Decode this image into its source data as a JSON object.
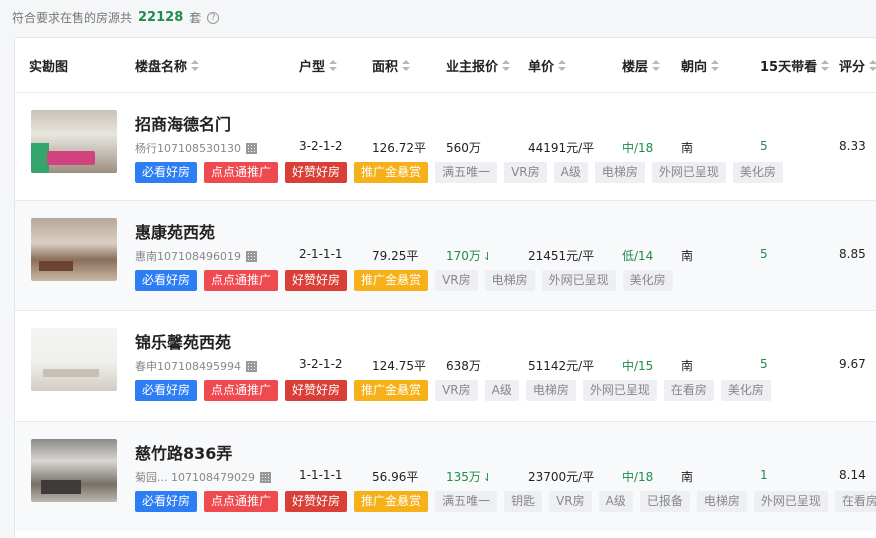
{
  "summary": {
    "prefix": "符合要求在售的房源共",
    "count": "22128",
    "suffix": "套",
    "help_icon": "question-circle-icon"
  },
  "columns": [
    {
      "label": "实勘图",
      "sortable": false
    },
    {
      "label": "楼盘名称",
      "sortable": true
    },
    {
      "label": "户型",
      "sortable": true
    },
    {
      "label": "面积",
      "sortable": true
    },
    {
      "label": "业主报价",
      "sortable": true
    },
    {
      "label": "单价",
      "sortable": true
    },
    {
      "label": "楼层",
      "sortable": true
    },
    {
      "label": "朝向",
      "sortable": true
    },
    {
      "label": "15天带看",
      "sortable": true
    },
    {
      "label": "评分",
      "sortable": true
    }
  ],
  "listings": [
    {
      "name": "招商海德名门",
      "code": "杨行107108530130",
      "layout": "3-2-1-2",
      "area": "126.72平",
      "price": "560万",
      "unit_price": "44191元/平",
      "floor": "中/18",
      "orientation": "南",
      "views": "5",
      "score": "8.33",
      "tags": [
        {
          "text": "必看好房",
          "style": "blue"
        },
        {
          "text": "点点通推广",
          "style": "red"
        },
        {
          "text": "好赞好房",
          "style": "darkred"
        },
        {
          "text": "推广金悬赏",
          "style": "orange"
        },
        {
          "text": "满五唯一",
          "style": "gray"
        },
        {
          "text": "VR房",
          "style": "gray"
        },
        {
          "text": "A级",
          "style": "gray"
        },
        {
          "text": "电梯房",
          "style": "gray"
        },
        {
          "text": "外网已呈现",
          "style": "gray"
        },
        {
          "text": "美化房",
          "style": "gray"
        }
      ]
    },
    {
      "name": "惠康苑西苑",
      "code": "惠南107108496019",
      "layout": "2-1-1-1",
      "area": "79.25平",
      "price": "170万",
      "price_trend": "down",
      "unit_price": "21451元/平",
      "floor": "低/14",
      "orientation": "南",
      "views": "5",
      "score": "8.85",
      "tags": [
        {
          "text": "必看好房",
          "style": "blue"
        },
        {
          "text": "点点通推广",
          "style": "red"
        },
        {
          "text": "好赞好房",
          "style": "darkred"
        },
        {
          "text": "推广金悬赏",
          "style": "orange"
        },
        {
          "text": "VR房",
          "style": "gray"
        },
        {
          "text": "电梯房",
          "style": "gray"
        },
        {
          "text": "外网已呈现",
          "style": "gray"
        },
        {
          "text": "美化房",
          "style": "gray"
        }
      ]
    },
    {
      "name": "锦乐馨苑西苑",
      "code": "春申107108495994",
      "layout": "3-2-1-2",
      "area": "124.75平",
      "price": "638万",
      "unit_price": "51142元/平",
      "floor": "中/15",
      "orientation": "南",
      "views": "5",
      "score": "9.67",
      "tags": [
        {
          "text": "必看好房",
          "style": "blue"
        },
        {
          "text": "点点通推广",
          "style": "red"
        },
        {
          "text": "好赞好房",
          "style": "darkred"
        },
        {
          "text": "推广金悬赏",
          "style": "orange"
        },
        {
          "text": "VR房",
          "style": "gray"
        },
        {
          "text": "A级",
          "style": "gray"
        },
        {
          "text": "电梯房",
          "style": "gray"
        },
        {
          "text": "外网已呈现",
          "style": "gray"
        },
        {
          "text": "在看房",
          "style": "gray"
        },
        {
          "text": "美化房",
          "style": "gray"
        }
      ]
    },
    {
      "name": "慈竹路836弄",
      "code": "菊园...  107108479029",
      "layout": "1-1-1-1",
      "area": "56.96平",
      "price": "135万",
      "price_trend": "down",
      "unit_price": "23700元/平",
      "floor": "中/18",
      "orientation": "南",
      "views": "1",
      "score": "8.14",
      "tags": [
        {
          "text": "必看好房",
          "style": "blue"
        },
        {
          "text": "点点通推广",
          "style": "red"
        },
        {
          "text": "好赞好房",
          "style": "darkred"
        },
        {
          "text": "推广金悬赏",
          "style": "orange"
        },
        {
          "text": "满五唯一",
          "style": "gray"
        },
        {
          "text": "钥匙",
          "style": "gray"
        },
        {
          "text": "VR房",
          "style": "gray"
        },
        {
          "text": "A级",
          "style": "gray"
        },
        {
          "text": "已报备",
          "style": "gray"
        },
        {
          "text": "电梯房",
          "style": "gray"
        },
        {
          "text": "外网已呈现",
          "style": "gray"
        },
        {
          "text": "在看房",
          "style": "gray"
        }
      ]
    }
  ],
  "colors": {
    "accent_green": "#1f8b4c",
    "tag_blue": "#2d7ef5",
    "tag_red": "#ef4a4f",
    "tag_darkred": "#d93f36",
    "tag_orange": "#f6b11a",
    "tag_gray": "#eeeff2"
  }
}
